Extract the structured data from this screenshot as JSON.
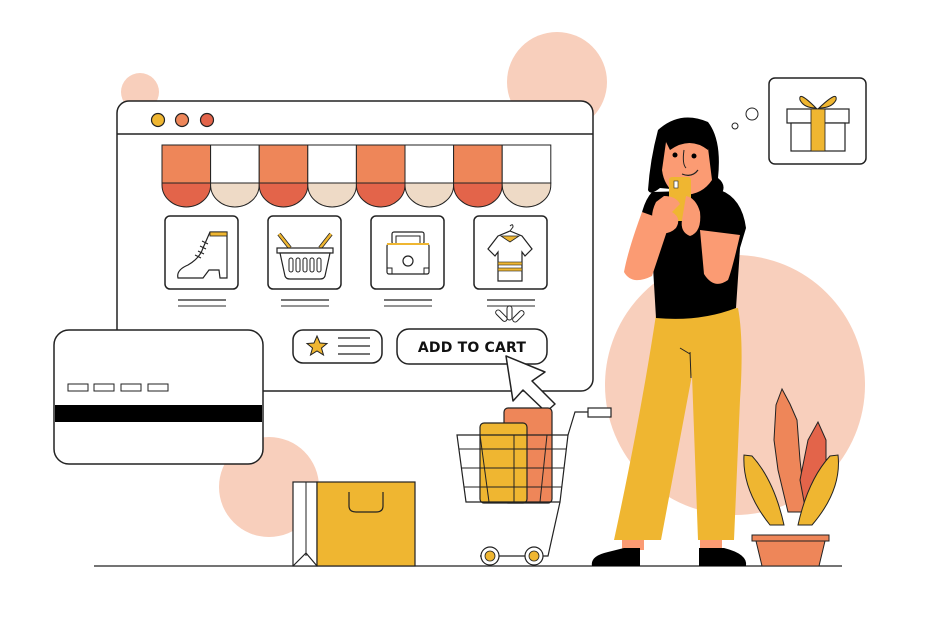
{
  "illustration": {
    "theme": "online shopping",
    "colors": {
      "peach": "#F8CFBC",
      "orange": "#EE8659",
      "red_orange": "#E3644A",
      "beige": "#EEDAC6",
      "yellow": "#EFB631",
      "skin": "#FB9B73",
      "outline": "#222222",
      "black": "#000000",
      "white": "#FFFFFF"
    }
  },
  "browser_window": {
    "traffic_lights": [
      {
        "name": "yellow-dot",
        "color": "#EFB631"
      },
      {
        "name": "orange-dot",
        "color": "#EE8659"
      },
      {
        "name": "red-dot",
        "color": "#E3644A"
      }
    ],
    "awning_stripes": 8,
    "products": [
      {
        "name": "boot",
        "icon": "boot-icon"
      },
      {
        "name": "basket",
        "icon": "basket-icon"
      },
      {
        "name": "bag",
        "icon": "handbag-icon"
      },
      {
        "name": "shirt",
        "icon": "shirt-icon"
      }
    ],
    "rating_button": {
      "icon": "star-icon"
    },
    "add_to_cart_button": {
      "label": "ADD TO CART"
    }
  },
  "credit_card": {
    "number_blocks": 4
  },
  "thought_bubble": {
    "icon": "gift-icon"
  },
  "shopping_cart": {
    "items": 2
  },
  "plant": {
    "pot": true
  }
}
